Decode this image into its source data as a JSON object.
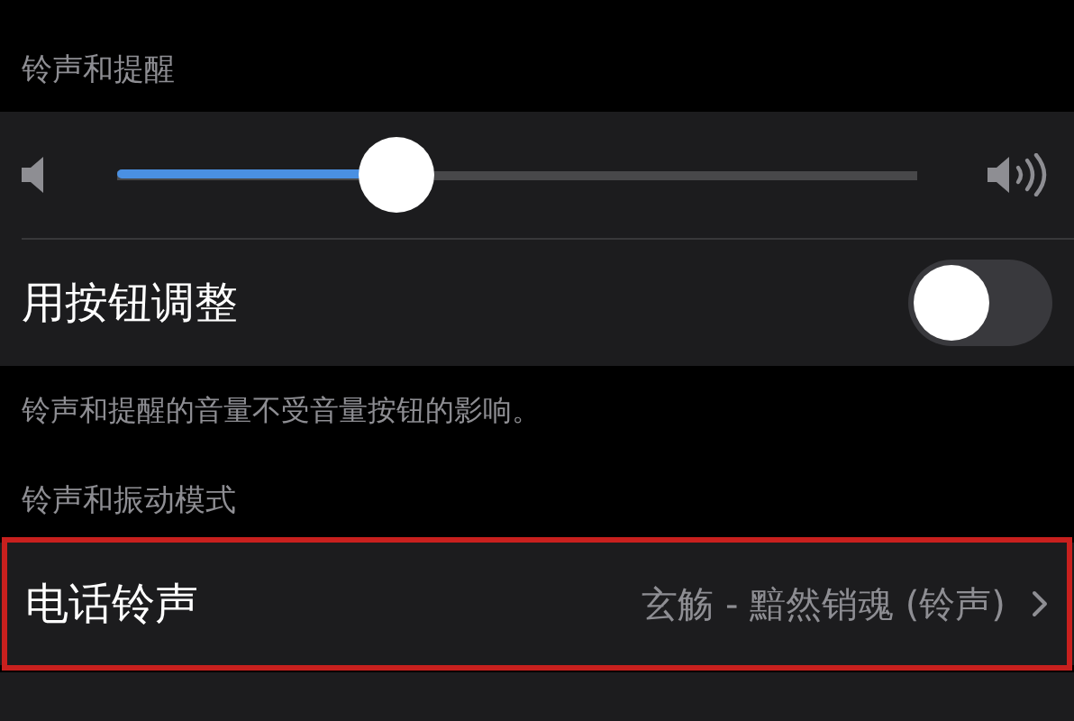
{
  "sections": [
    {
      "header": "铃声和提醒",
      "rows": [
        {
          "kind": "slider",
          "level": 0.35
        },
        {
          "kind": "toggle",
          "label": "用按钮调整",
          "on": false
        }
      ],
      "footer": "铃声和提醒的音量不受音量按钮的影响。"
    },
    {
      "header": "铃声和振动模式",
      "rows": [
        {
          "kind": "link",
          "label": "电话铃声",
          "value": "玄觞 - 黯然销魂 (铃声)",
          "highlighted": true
        }
      ]
    }
  ]
}
